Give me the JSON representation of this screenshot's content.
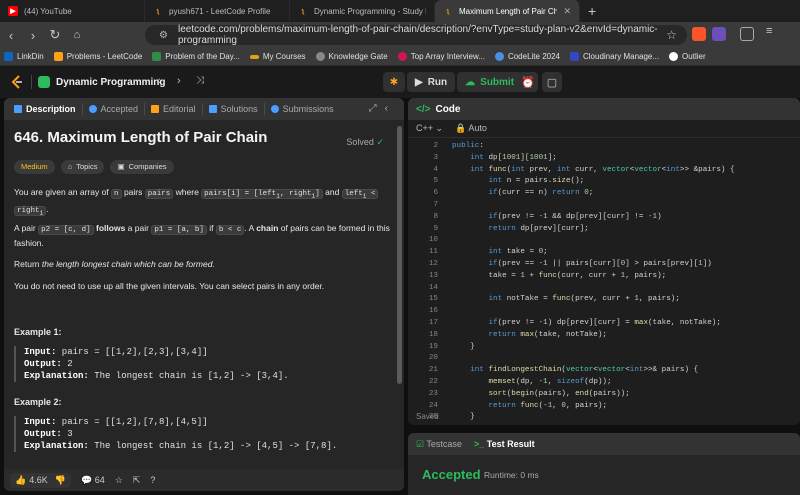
{
  "browser": {
    "tabs": [
      {
        "title": "(44) YouTube",
        "active": false,
        "icon": "youtube-icon",
        "color": "#ff0000"
      },
      {
        "title": "pyush671 - LeetCode Profile",
        "active": false,
        "icon": "leetcode-icon",
        "color": "#ffa116"
      },
      {
        "title": "Dynamic Programming - Study Plan",
        "active": false,
        "icon": "leetcode-icon",
        "color": "#ffa116"
      },
      {
        "title": "Maximum Length of Pair Chain",
        "active": true,
        "icon": "leetcode-icon",
        "color": "#ffa116"
      }
    ],
    "url": "leetcode.com/problems/maximum-length-of-pair-chain/description/?envType=study-plan-v2&envId=dynamic-programming",
    "bookmarks": [
      {
        "label": "LinkDin",
        "color": "#0a66c2"
      },
      {
        "label": "Problems - LeetCode",
        "color": "#ffa116"
      },
      {
        "label": "Problem of the Day...",
        "color": "#2f8d46"
      },
      {
        "label": "My Courses",
        "color": "#e5a00d"
      },
      {
        "label": "Knowledge Gate",
        "color": "#888888"
      },
      {
        "label": "Top Array Interview...",
        "color": "#d4145a"
      },
      {
        "label": "CodeLite 2024",
        "color": "#4a90e2"
      },
      {
        "label": "Cloudinary Manage...",
        "color": "#3448c5"
      },
      {
        "label": "Outlier",
        "color": "#ffffff"
      }
    ]
  },
  "header": {
    "title": "Dynamic Programming",
    "run": "Run",
    "submit": "Submit"
  },
  "left": {
    "tabs": {
      "description": "Description",
      "accepted": "Accepted",
      "editorial": "Editorial",
      "solutions": "Solutions",
      "submissions": "Submissions"
    },
    "title": "646. Maximum Length of Pair Chain",
    "solved": "Solved",
    "chips": {
      "difficulty": "Medium",
      "topics": "Topics",
      "companies": "Companies"
    },
    "p1": {
      "a": "You are given an array of",
      "n": "n",
      "b": "pairs",
      "pairs": "pairs",
      "c": "where",
      "pairsi": "pairs[i] = [left",
      "pairsi2": ", right",
      "pairsi3": "]",
      "d": "and",
      "cond": "left",
      "cond2": " <",
      "right": "right",
      "end": "."
    },
    "p2": {
      "a": "A pair",
      "p2": "p2 = [c, d]",
      "follows": "follows",
      "b": "a pair",
      "p1": "p1 = [a, b]",
      "c": "if",
      "cond": "b < c",
      "d": ". A",
      "chain": "chain",
      "e": "of pairs can be formed in this fashion."
    },
    "p3": {
      "a": "Return",
      "b": "the length longest chain which can be formed."
    },
    "p4": "You do not need to use up all the given intervals. You can select pairs in any order.",
    "ex1": {
      "heading": "Example 1:",
      "input_label": "Input:",
      "input": " pairs = [[1,2],[2,3],[3,4]]",
      "output_label": "Output:",
      "output": " 2",
      "expl_label": "Explanation:",
      "expl": " The longest chain is [1,2] -> [3,4]."
    },
    "ex2": {
      "heading": "Example 2:",
      "input_label": "Input:",
      "input": " pairs = [[1,2],[7,8],[4,5]]",
      "output_label": "Output:",
      "output": " 3",
      "expl_label": "Explanation:",
      "expl": " The longest chain is [1,2] -> [4,5] -> [7,8]."
    },
    "footer": {
      "likes": "4.6K",
      "comments": "64"
    }
  },
  "code": {
    "title": "Code",
    "language": "C++",
    "mode": "Auto",
    "saved": "Saved",
    "lines": [
      {
        "n": "2",
        "html": "<span class='kw'>public</span>:"
      },
      {
        "n": "3",
        "html": "    <span class='kw'>int</span> dp[<span class='nm'>1001</span>][<span class='nm'>1001</span>];"
      },
      {
        "n": "4",
        "html": "    <span class='kw'>int</span> <span class='fn'>func</span>(<span class='kw'>int</span> prev, <span class='kw'>int</span> curr, <span class='ty'>vector</span>&lt;<span class='ty'>vector</span>&lt;<span class='kw'>int</span>&gt;&gt; &amp;pairs) {"
      },
      {
        "n": "5",
        "html": "        <span class='kw'>int</span> n = pairs.<span class='fn'>size</span>();"
      },
      {
        "n": "6",
        "html": "        <span class='kw'>if</span>(curr == n) <span class='kw'>return</span> <span class='nm'>0</span>;"
      },
      {
        "n": "7",
        "html": ""
      },
      {
        "n": "8",
        "html": "        <span class='kw'>if</span>(prev != <span class='nm'>-1</span> &amp;&amp; dp[prev][curr] != <span class='nm'>-1</span>)"
      },
      {
        "n": "9",
        "html": "        <span class='kw'>return</span> dp[prev][curr];"
      },
      {
        "n": "10",
        "html": ""
      },
      {
        "n": "11",
        "html": "        <span class='kw'>int</span> take = <span class='nm'>0</span>;"
      },
      {
        "n": "12",
        "html": "        <span class='kw'>if</span>(prev == <span class='nm'>-1</span> || pairs[curr][<span class='nm'>0</span>] &gt; pairs[prev][<span class='nm'>1</span>])"
      },
      {
        "n": "13",
        "html": "        take = <span class='nm'>1</span> + <span class='fn'>func</span>(curr, curr + <span class='nm'>1</span>, pairs);"
      },
      {
        "n": "14",
        "html": ""
      },
      {
        "n": "15",
        "html": "        <span class='kw'>int</span> notTake = <span class='fn'>func</span>(prev, curr + <span class='nm'>1</span>, pairs);"
      },
      {
        "n": "16",
        "html": ""
      },
      {
        "n": "17",
        "html": "        <span class='kw'>if</span>(prev != <span class='nm'>-1</span>) dp[prev][curr] = <span class='fn'>max</span>(take, notTake);"
      },
      {
        "n": "18",
        "html": "        <span class='kw'>return</span> <span class='fn'>max</span>(take, notTake);"
      },
      {
        "n": "19",
        "html": "    }"
      },
      {
        "n": "20",
        "html": ""
      },
      {
        "n": "21",
        "html": "    <span class='kw'>int</span> <span class='fn'>findLongestChain</span>(<span class='ty'>vector</span>&lt;<span class='ty'>vector</span>&lt;<span class='kw'>int</span>&gt;&gt;&amp; pairs) {"
      },
      {
        "n": "22",
        "html": "        <span class='fn'>memset</span>(dp, <span class='nm'>-1</span>, <span class='kw'>sizeof</span>(dp));"
      },
      {
        "n": "23",
        "html": "        <span class='fn'>sort</span>(<span class='fn'>begin</span>(pairs), <span class='fn'>end</span>(pairs));"
      },
      {
        "n": "24",
        "html": "        <span class='kw'>return</span> <span class='fn'>func</span>(<span class='nm'>-1</span>, <span class='nm'>0</span>, pairs);"
      },
      {
        "n": "25",
        "html": "    }"
      }
    ]
  },
  "result": {
    "tab_testcase": "Testcase",
    "tab_result": "Test Result",
    "status": "Accepted",
    "runtime": "Runtime: 0 ms"
  }
}
